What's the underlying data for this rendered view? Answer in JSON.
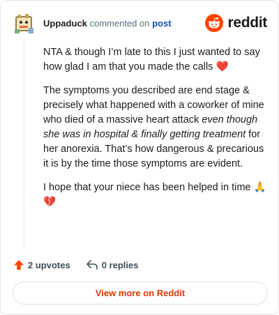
{
  "header": {
    "username": "Uppaduck",
    "action_text": "commented on",
    "post_link": "post",
    "brand": "reddit"
  },
  "comment": {
    "p1": "NTA & though I’m late to this I just wanted to say how glad I am that you made the calls",
    "p1_emoji": "❤️",
    "p2_a": "The symptoms you described are end stage & precisely what happened with a coworker of mine who died of a massive heart attack ",
    "p2_em": "even though she was in hospital & finally getting treatment",
    "p2_b": " for her anorexia. That’s how dangerous & precarious it is by the time those symptoms are evident.",
    "p3": "I hope that your niece has been helped in time",
    "p3_emoji": "🙏",
    "p3_emoji2": "💔"
  },
  "actions": {
    "upvotes": "2 upvotes",
    "replies": "0 replies"
  },
  "footer": {
    "view_more": "View more on Reddit"
  },
  "colors": {
    "brand": "#ff4500",
    "link": "#0a4fb6",
    "button_text": "#d93a00"
  }
}
